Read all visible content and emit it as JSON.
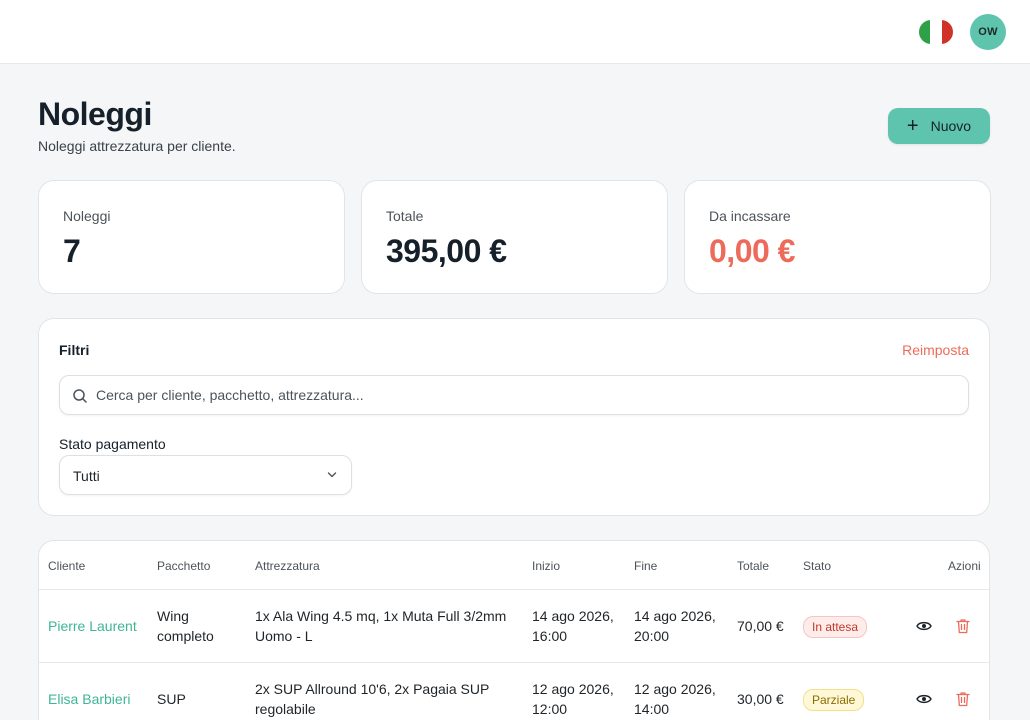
{
  "topbar": {
    "flag": {
      "icon": "italy-flag-icon",
      "colors": [
        "#2fa04a",
        "#ffffff",
        "#d0322a"
      ]
    },
    "avatar_initials": "OW"
  },
  "header": {
    "title": "Noleggi",
    "subtitle": "Noleggi attrezzatura per cliente.",
    "new_button_label": "Nuovo"
  },
  "stats": [
    {
      "label": "Noleggi",
      "value": "7"
    },
    {
      "label": "Totale",
      "value": "395,00 €"
    },
    {
      "label": "Da incassare",
      "value": "0,00 €"
    }
  ],
  "filters": {
    "title": "Filtri",
    "reset_label": "Reimposta",
    "search_placeholder": "Cerca per cliente, pacchetto, attrezzatura...",
    "search_value": "",
    "payment_status_label": "Stato pagamento",
    "payment_status_value": "Tutti"
  },
  "table": {
    "columns": [
      "Cliente",
      "Pacchetto",
      "Attrezzatura",
      "Inizio",
      "Fine",
      "Totale",
      "Stato",
      "Azioni"
    ],
    "rows": [
      {
        "client": "Pierre Laurent",
        "package": [
          "Wing",
          "completo"
        ],
        "equipment": [
          "1x Ala Wing 4.5 mq, 1x Muta Full 3/2mm",
          "Uomo - L"
        ],
        "start": [
          "14 ago 2026,",
          "16:00"
        ],
        "end": [
          "14 ago 2026,",
          "20:00"
        ],
        "total": "70,00 €",
        "status": "In attesa"
      },
      {
        "client": "Elisa Barbieri",
        "package": [
          "SUP"
        ],
        "equipment": [
          "2x SUP Allround 10'6, 2x Pagaia SUP",
          "regolabile"
        ],
        "start": [
          "12 ago 2026,",
          "12:00"
        ],
        "end": [
          "12 ago 2026,",
          "14:00"
        ],
        "total": "30,00 €",
        "status": "Parziale"
      }
    ]
  },
  "colors": {
    "accent": "#5ec4ae",
    "client_link": "#3fb597",
    "due": "#ec6b5a",
    "badge_wait": "#c0392b",
    "badge_partial": "#8a6d00"
  }
}
